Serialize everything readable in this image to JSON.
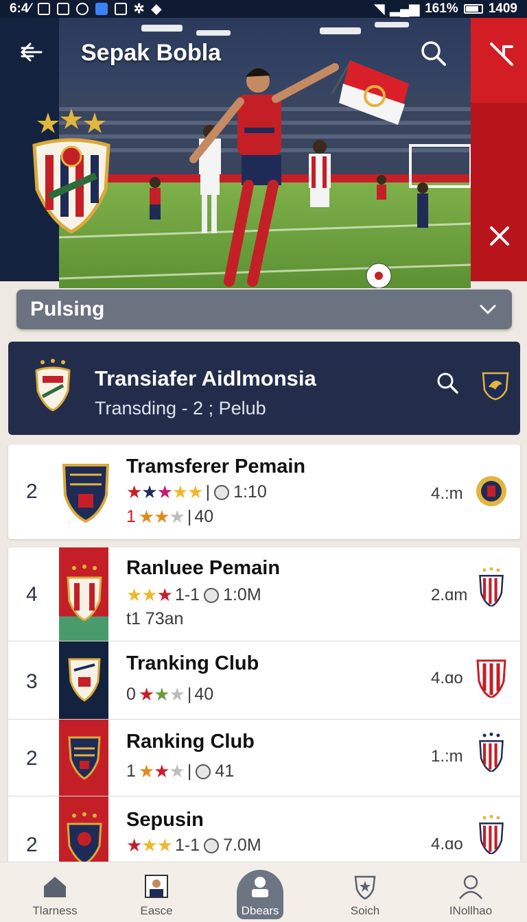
{
  "status_bar": {
    "time_left": "6:4⁄",
    "battery": "161%",
    "time_right": "1409"
  },
  "hero": {
    "title": "Sepak Bobla"
  },
  "filter": {
    "selected": "Pulsing"
  },
  "header_card": {
    "title": "Transiafer Aidlmonsia",
    "subtitle": "Transding - 2 ; Pelub"
  },
  "rows": [
    {
      "rank": "2",
      "title": "Tramsferer Pemain",
      "stat1": "1:10",
      "stat2_num": "1",
      "stat2_val": "40",
      "time": "4.:m"
    },
    {
      "rank": "4",
      "title": "Ranluee Pemain",
      "stat1_pre": "1-1",
      "stat1": "1:0M",
      "line2": "t1 73an",
      "time": "2.ɑm"
    },
    {
      "rank": "3",
      "title": "Tranking Club",
      "stat_num": "0",
      "stat_val": "40",
      "time": "4.ɑo"
    },
    {
      "rank": "2",
      "title": "Ranking Club",
      "stat_num": "1",
      "stat_val": "41",
      "time": "1.:m"
    },
    {
      "rank": "2",
      "title": "Sepusin",
      "stat1_pre": "1-1",
      "stat1": "7.0M",
      "time": "4.ɑo"
    }
  ],
  "bottom_nav": [
    {
      "label": "Tlarness",
      "icon": "home-icon"
    },
    {
      "label": "Easce",
      "icon": "player-card-icon"
    },
    {
      "label": "Dbears",
      "icon": "briefcase-icon",
      "active": true
    },
    {
      "label": "Soich",
      "icon": "shield-icon"
    },
    {
      "label": "INollhao",
      "icon": "profile-icon"
    }
  ],
  "colors": {
    "navy": "#232d4b",
    "red": "#c81d28",
    "gold": "#efb82b",
    "dropdown": "#6c7380"
  }
}
